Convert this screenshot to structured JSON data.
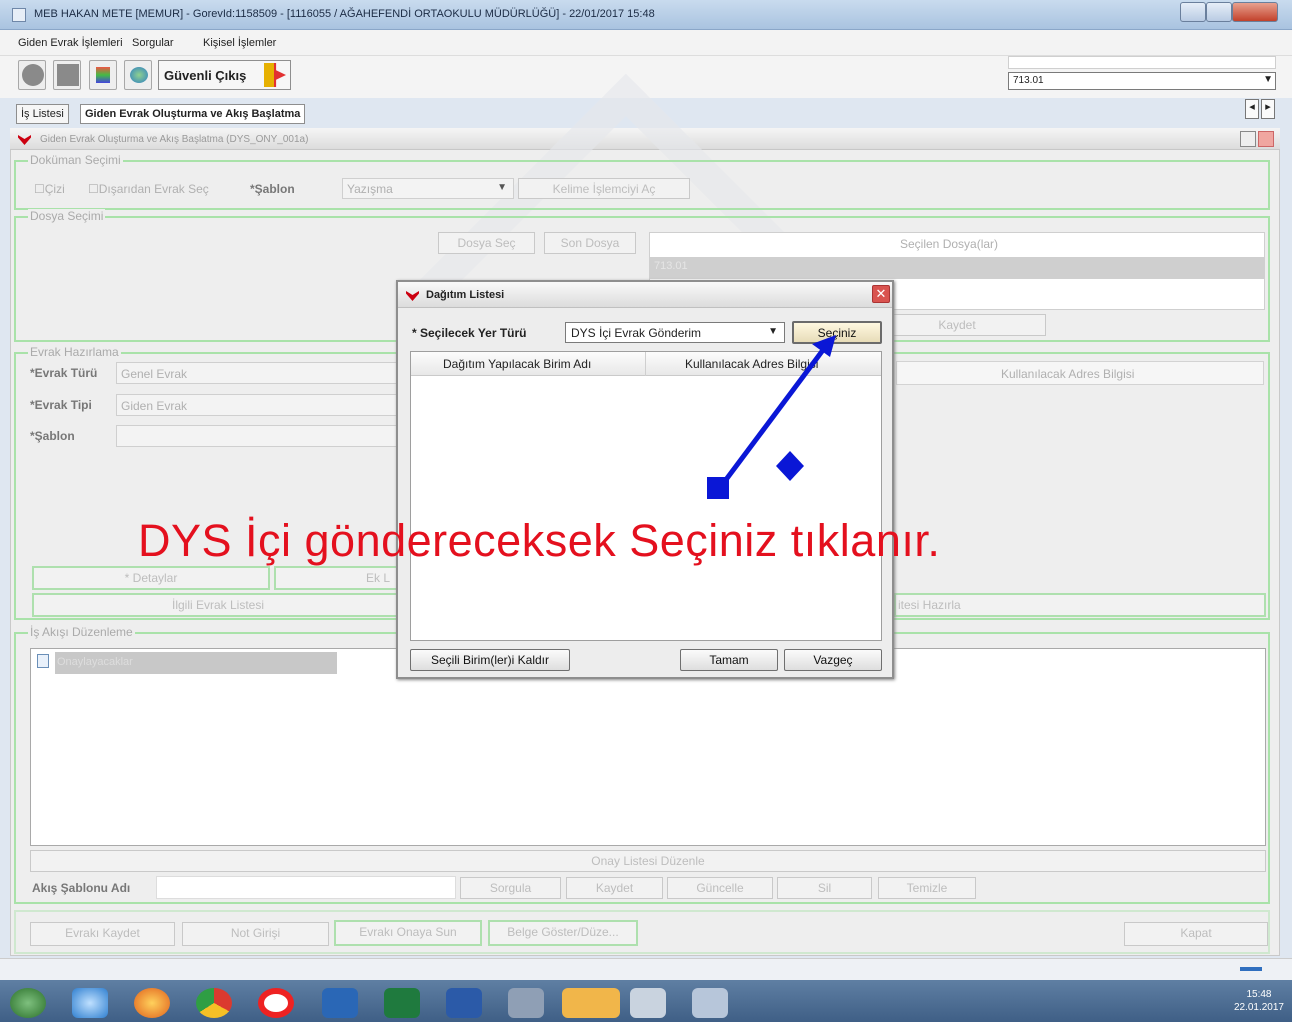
{
  "window": {
    "title": "MEB  HAKAN METE  [MEMUR] - GorevId:1158509 - [1116055 / AĞAHEFENDİ ORTAOKULU MÜDÜRLÜĞÜ] - 22/01/2017 15:48"
  },
  "menu": [
    "Giden Evrak İşlemleri",
    "Sorgular",
    "Kişisel İşlemler"
  ],
  "toolbar": {
    "guvenli_cikis": "Güvenli Çıkış",
    "unit_code": "713.01"
  },
  "tabs": [
    "İş Listesi",
    "Giden Evrak Oluşturma ve Akış Başlatma"
  ],
  "frame": {
    "title": "Giden Evrak Oluşturma ve Akış Başlatma (DYS_ONY_001a)"
  },
  "dokuman": {
    "group": "Doküman Seçimi",
    "cizim": "Çizi",
    "disardan": "Dışarıdan Evrak Seç",
    "sablon_label": "*Şablon",
    "sablon_value": "Yazışma",
    "kelime": "Kelime İşlemciyi Aç"
  },
  "dosya": {
    "group": "Dosya Seçimi",
    "dosya_sec": "Dosya Seç",
    "son_dosya": "Son Dosya",
    "secilen_header": "Seçilen Dosya(lar)",
    "secilen_row": "713.01",
    "kaydet": "Kaydet"
  },
  "evrak": {
    "group": "Evrak Hazırlama",
    "turu_label": "Evrak Türü",
    "turu_value": "Genel Evrak",
    "tipi_label": "Evrak Tipi",
    "tipi_value": "Giden Evrak",
    "sablon_label": "Şablon",
    "adres_header": "Kullanılacak Adres Bilgisi",
    "detaylar": "* Detaylar",
    "ek": "Ek L",
    "ilgili": "İlgili Evrak Listesi",
    "liste_hazirla": "itesi Hazırla"
  },
  "akis": {
    "group": "İş Akışı Düzenleme",
    "tree_item": "Onaylayacaklar",
    "onay_listesi": "Onay Listesi Düzenle",
    "sablon_adi": "Akış Şablonu Adı",
    "sorgula": "Sorgula",
    "kaydet": "Kaydet",
    "guncelle": "Güncelle",
    "sil": "Sil",
    "temizle": "Temizle"
  },
  "bottom": {
    "evraki_kaydet": "Evrakı Kaydet",
    "not_girisi": "Not Girişi",
    "onaya_sun": "Evrakı Onaya Sun",
    "belge_goster": "Belge Göster/Düze...",
    "kapat": "Kapat"
  },
  "dialog": {
    "title": "Dağıtım Listesi",
    "yer_turu_label": "* Seçilecek Yer Türü",
    "yer_turu_value": "DYS İçi Evrak Gönderim",
    "seciniz": "Seçiniz",
    "col1": "Dağıtım Yapılacak Birim Adı",
    "col2": "Kullanılacak Adres Bilgisi",
    "kaldir": "Seçili Birim(ler)i Kaldır",
    "tamam": "Tamam",
    "vazgec": "Vazgeç"
  },
  "annotation": "DYS İçi göndereceksek Seçiniz tıklanır.",
  "clock": {
    "time": "15:48",
    "date": "22.01.2017"
  },
  "colors": {
    "annotation": "#e4101e",
    "arrow": "#0a17d6",
    "group_border": "#a9e2a9"
  }
}
